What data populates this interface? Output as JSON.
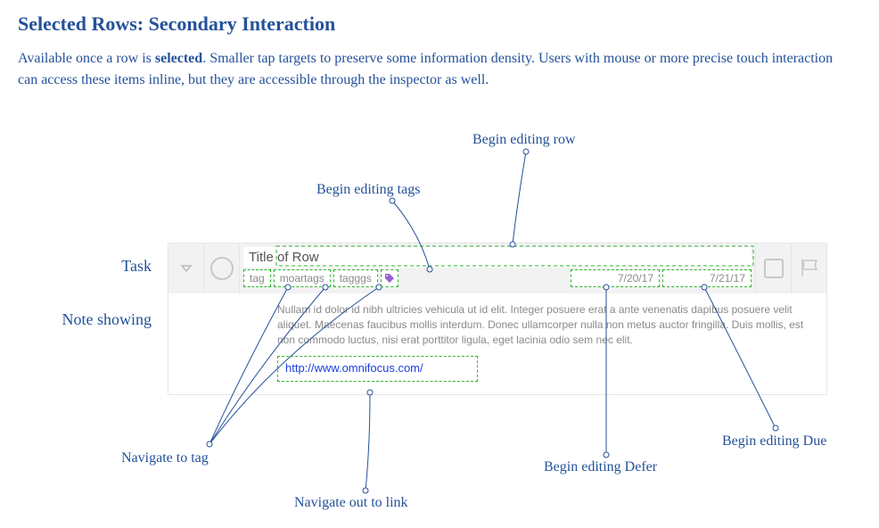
{
  "heading": "Selected Rows: Secondary Interaction",
  "description_pre": "Available once a row is ",
  "description_bold": "selected",
  "description_post": ".  Smaller tap targets to preserve some information density.  Users with mouse or more precise touch interaction can access these items inline, but they are accessible through the inspector as well.",
  "side": {
    "task": "Task",
    "note": "Note showing"
  },
  "row": {
    "title": "Title of Row",
    "tags": [
      "tag",
      "moartags",
      "tagggs"
    ],
    "defer": "7/20/17",
    "due": "7/21/17",
    "note": "Nullam id dolor id nibh ultricies vehicula ut id elit. Integer posuere erat a ante venenatis dapibus posuere velit aliquet. Maecenas faucibus mollis interdum. Donec ullamcorper nulla non metus auctor fringilla. Duis mollis, est non commodo luctus, nisi erat porttitor ligula, eget lacinia odio sem nec elit.",
    "link": "http://www.omnifocus.com/"
  },
  "ann": {
    "edit_row": "Begin editing row",
    "edit_tags": "Begin editing tags",
    "nav_tag": "Navigate to tag",
    "nav_link": "Navigate out to link",
    "edit_defer": "Begin editing Defer",
    "edit_due": "Begin editing Due"
  }
}
